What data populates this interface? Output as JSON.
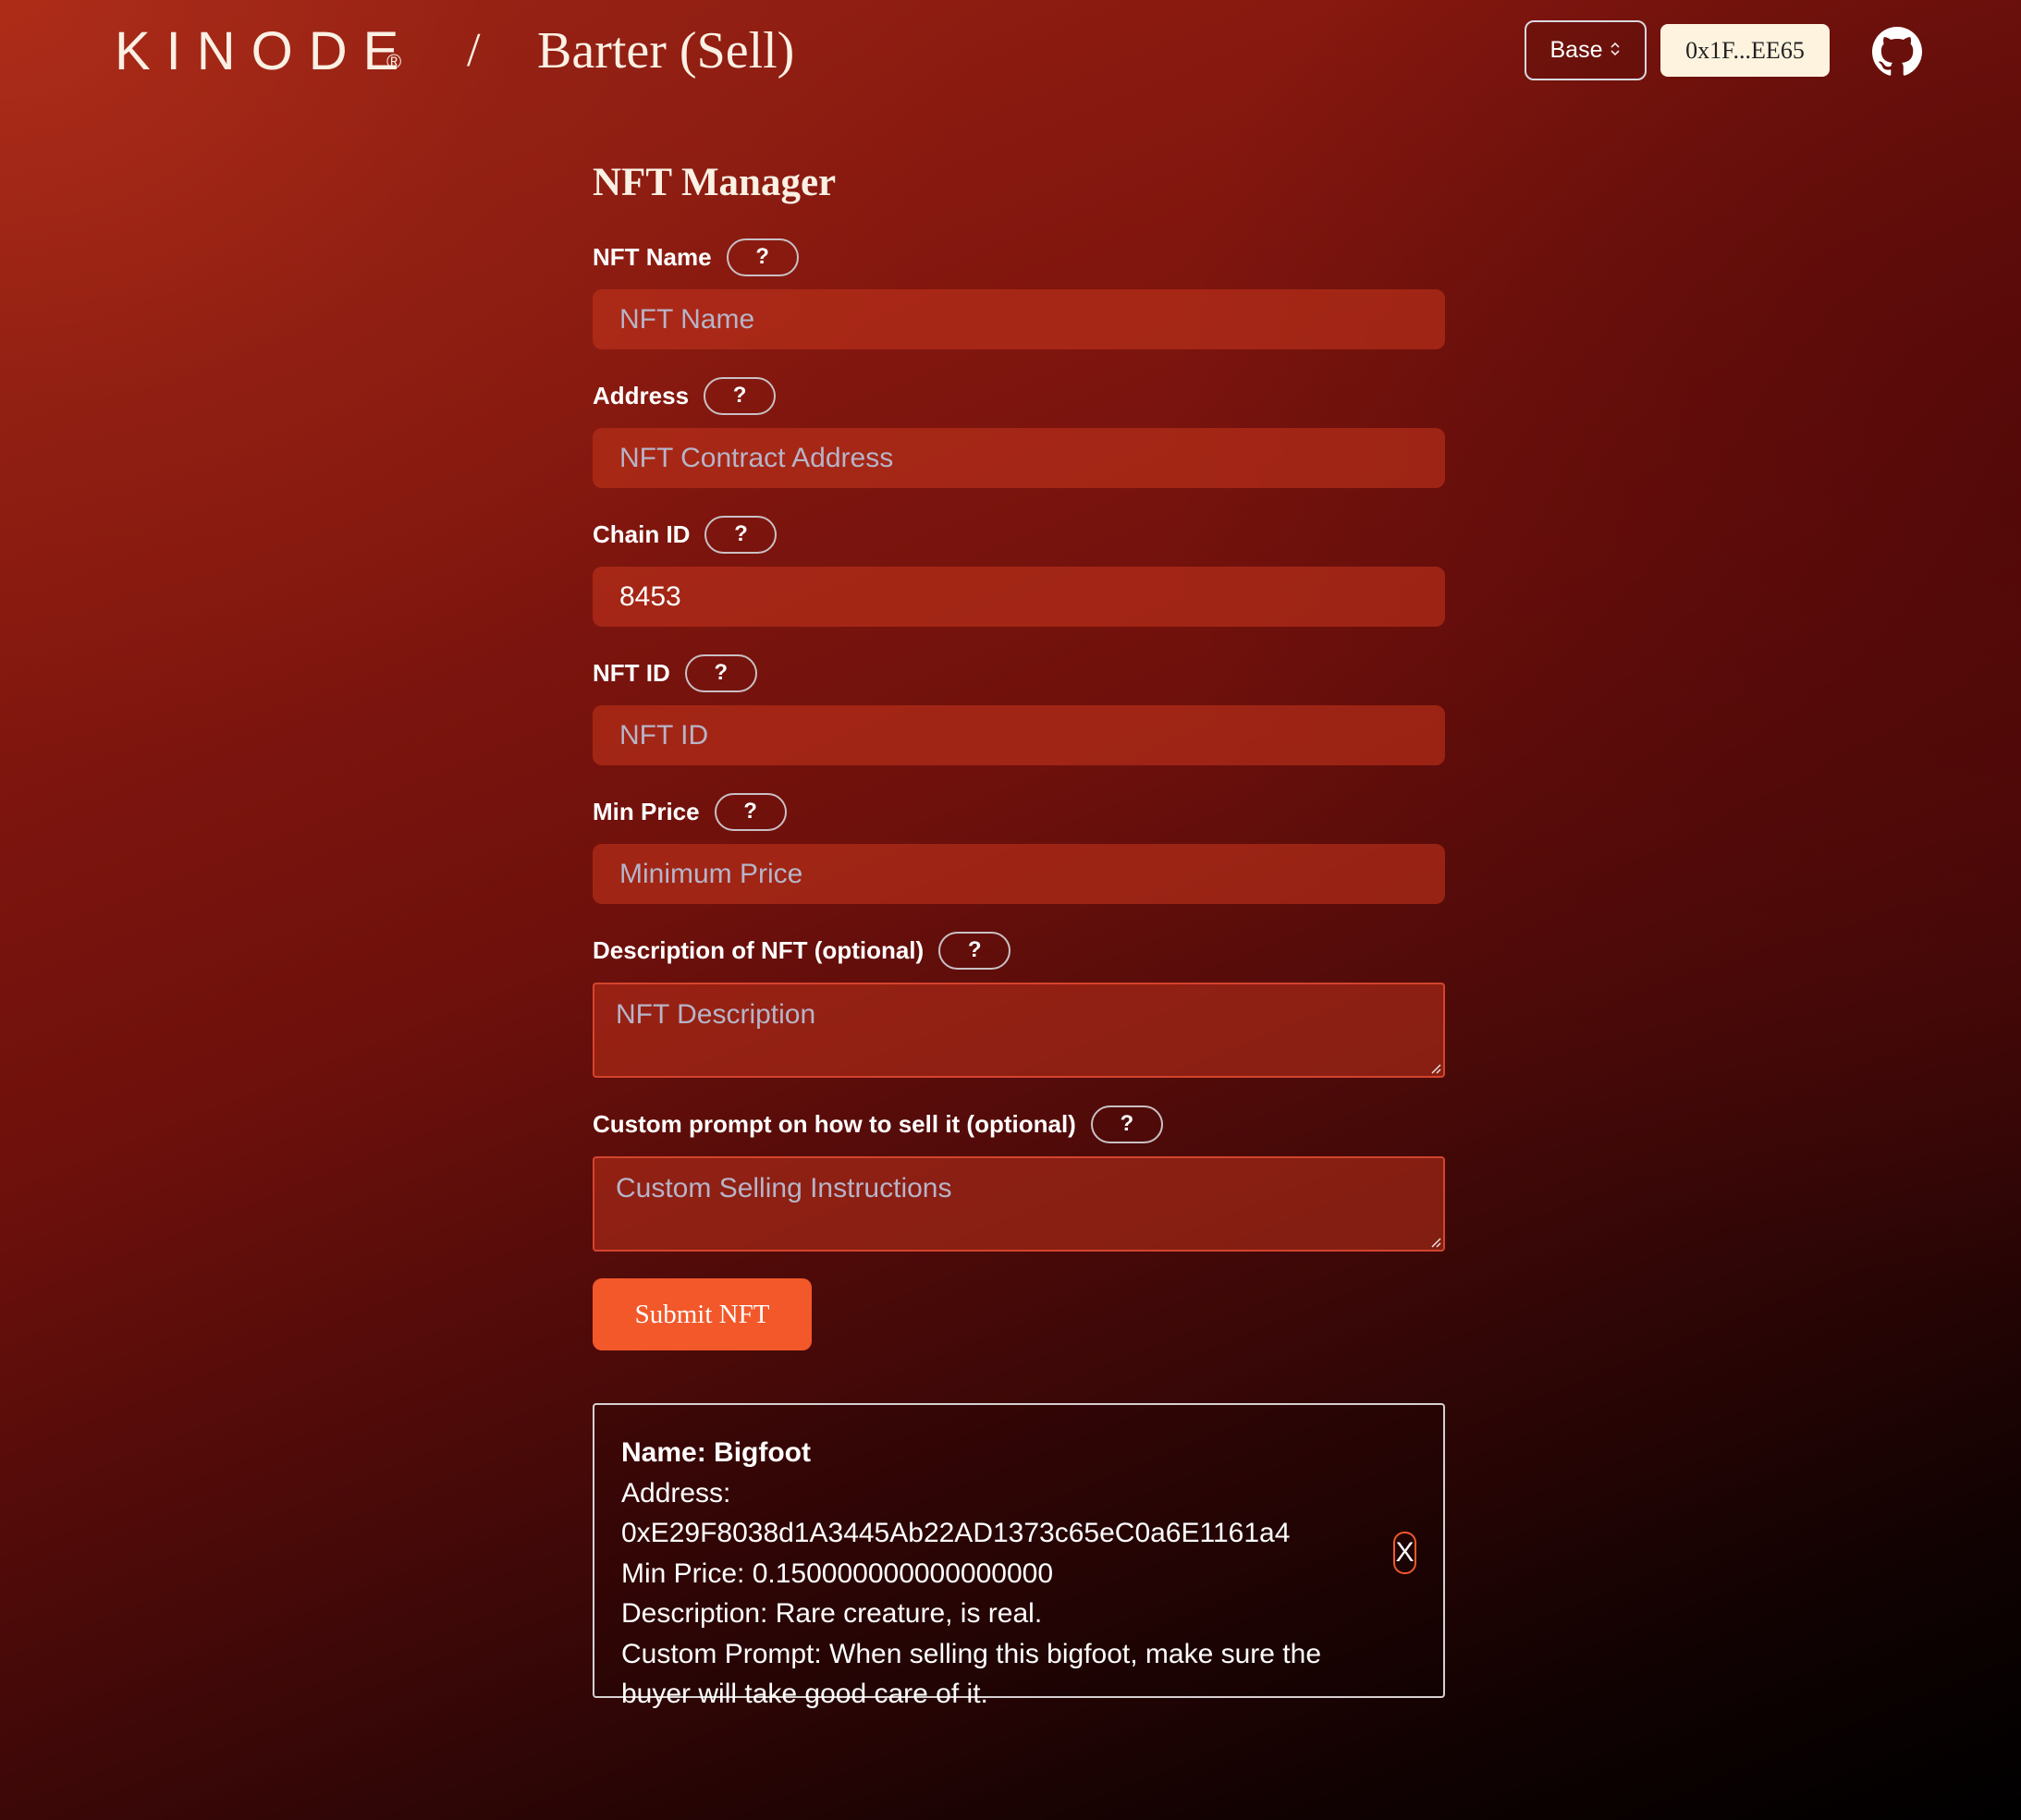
{
  "header": {
    "logo": "KINODE",
    "logo_mark": "®",
    "separator": "/",
    "title": "Barter (Sell)",
    "network_label": "Base",
    "network_chevron": "⌃⌄",
    "wallet_address": "0x1F...EE65",
    "github_icon": "github-icon"
  },
  "form": {
    "title": "NFT Manager",
    "help_label": "?",
    "fields": [
      {
        "label": "NFT Name",
        "placeholder": "NFT Name",
        "value": ""
      },
      {
        "label": "Address",
        "placeholder": "NFT Contract Address",
        "value": ""
      },
      {
        "label": "Chain ID",
        "placeholder": "",
        "value": "8453"
      },
      {
        "label": "NFT ID",
        "placeholder": "NFT ID",
        "value": ""
      },
      {
        "label": "Min Price",
        "placeholder": "Minimum Price",
        "value": ""
      },
      {
        "label": "Description of NFT (optional)",
        "placeholder": "NFT Description",
        "value": ""
      },
      {
        "label": "Custom prompt on how to sell it (optional)",
        "placeholder": "Custom Selling Instructions",
        "value": ""
      }
    ],
    "submit_label": "Submit NFT"
  },
  "nft_card": {
    "name": "Name: Bigfoot",
    "address": "Address: 0xE29F8038d1A3445Ab22AD1373c65eC0a6E1161a4",
    "min_price": "Min Price: 0.150000000000000000",
    "description": "Description: Rare creature, is real.",
    "custom_prompt": "Custom Prompt: When selling this bigfoot, make sure the buyer will take good care of it.",
    "close_label": "X"
  },
  "colors": {
    "accent": "#f2582a",
    "wallet_bg": "#fdf3df",
    "input_bg": "#b5301c",
    "text_light": "#fbf0e4"
  }
}
